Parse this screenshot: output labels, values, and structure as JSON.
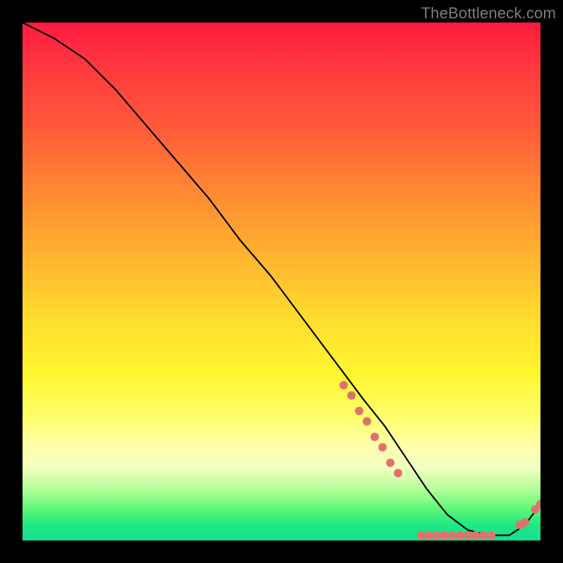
{
  "watermark": "TheBottleneck.com",
  "chart_data": {
    "type": "line",
    "title": "",
    "xlabel": "",
    "ylabel": "",
    "xlim": [
      0,
      100
    ],
    "ylim": [
      0,
      100
    ],
    "grid": false,
    "legend": false,
    "series": [
      {
        "name": "curve",
        "style": "line",
        "color": "#000000",
        "x": [
          0,
          6,
          12,
          18,
          24,
          30,
          36,
          42,
          48,
          54,
          60,
          66,
          70,
          74,
          78,
          82,
          86,
          90,
          94,
          97,
          100
        ],
        "y": [
          100,
          97,
          93,
          87,
          80,
          73,
          66,
          58,
          51,
          43,
          35,
          27,
          22,
          16,
          10,
          5,
          2,
          1,
          1,
          3,
          7
        ]
      },
      {
        "name": "dots-descent",
        "style": "scatter",
        "color": "#e2716e",
        "x": [
          62,
          63.5,
          65,
          66.5,
          68,
          69.5,
          71,
          72.5
        ],
        "y": [
          30,
          28,
          25,
          23,
          20,
          18,
          15,
          13
        ]
      },
      {
        "name": "dots-valley",
        "style": "scatter",
        "color": "#e2716e",
        "x": [
          77,
          78.5,
          80,
          81.5,
          83,
          84.5,
          86,
          87.5,
          89,
          90.5
        ],
        "y": [
          1,
          1,
          1,
          1,
          1,
          1,
          1,
          1,
          1,
          1
        ]
      },
      {
        "name": "dots-rise",
        "style": "scatter",
        "color": "#e2716e",
        "x": [
          96,
          97,
          99,
          100
        ],
        "y": [
          3,
          3.5,
          6,
          7
        ]
      }
    ]
  }
}
